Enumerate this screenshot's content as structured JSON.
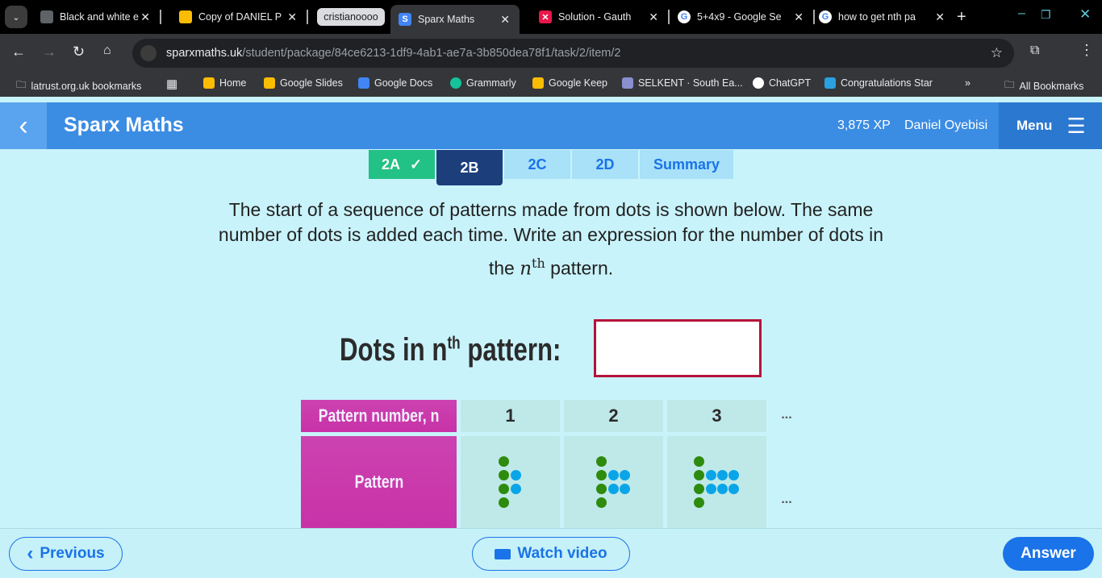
{
  "browser": {
    "tabs": [
      {
        "title": "Black and white e",
        "icon": "classroom-icon",
        "color": "#5f6368"
      },
      {
        "title": "Copy of DANIEL P",
        "icon": "slides-icon",
        "color": "#fbbc04"
      },
      {
        "title": "cristianoooo",
        "group": true
      },
      {
        "title": "Sparx Maths",
        "icon": "sparx-icon",
        "color": "#4285f4",
        "active": true
      },
      {
        "title": "Solution - Gauth",
        "icon": "gauth-icon",
        "color": "#e8174a"
      },
      {
        "title": "5+4x9 - Google Se",
        "icon": "google-icon",
        "color": "#ffffff"
      },
      {
        "title": "how to get nth pa",
        "icon": "google-icon",
        "color": "#ffffff"
      }
    ],
    "url_domain": "sparxmaths.uk",
    "url_path": "/student/package/84ce6213-1df9-4ab1-ae7a-3b850dea78f1/task/2/item/2",
    "bookmarks": [
      {
        "label": "latrust.org.uk bookmarks",
        "icon": "folder-icon"
      },
      {
        "label": "Home",
        "icon": "classroom-icon",
        "color": "#fbbc04"
      },
      {
        "label": "Google Slides",
        "icon": "slides-icon",
        "color": "#fbbc04"
      },
      {
        "label": "Google Docs",
        "icon": "docs-icon",
        "color": "#4285f4"
      },
      {
        "label": "Grammarly",
        "icon": "grammarly-icon",
        "color": "#15c39a"
      },
      {
        "label": "Google Keep",
        "icon": "keep-icon",
        "color": "#fbbc04"
      },
      {
        "label": "SELKENT · South Ea...",
        "icon": "selkent-icon",
        "color": "#8a8fd0"
      },
      {
        "label": "ChatGPT",
        "icon": "chatgpt-icon",
        "color": "#ffffff"
      },
      {
        "label": "Congratulations Star",
        "icon": "t-icon",
        "color": "#2aa1e0"
      }
    ],
    "all_bookmarks": "All Bookmarks"
  },
  "header": {
    "title": "Sparx Maths",
    "xp": "3,875 XP",
    "user": "Daniel Oyebisi",
    "menu": "Menu"
  },
  "task_tabs": [
    {
      "label": "2A",
      "state": "done"
    },
    {
      "label": "2B",
      "state": "active"
    },
    {
      "label": "2C",
      "state": "todo"
    },
    {
      "label": "2D",
      "state": "todo"
    },
    {
      "label": "Summary",
      "state": "todo"
    }
  ],
  "question": {
    "line1": "The start of a sequence of patterns made from dots is shown below. The same",
    "line2": "number of dots is added each time. Write an expression for the number of dots in",
    "line3_pre": "the ",
    "n": "n",
    "th": "th",
    "line3_post": " pattern."
  },
  "answer": {
    "label_pre": "Dots in n",
    "label_sup": "th",
    "label_post": " pattern:",
    "value": ""
  },
  "table": {
    "row1_header": "Pattern number, n",
    "row2_header": "Pattern",
    "columns": [
      "1",
      "2",
      "3"
    ],
    "ellipsis": "...",
    "patterns": [
      {
        "green": 4,
        "blue": 2
      },
      {
        "green": 4,
        "blue": 4
      },
      {
        "green": 4,
        "blue": 6
      }
    ],
    "colors": {
      "green": "#2e8b0e",
      "blue": "#0aa5e8",
      "header": "#c832a8",
      "cell": "#bfe9e8"
    }
  },
  "footer": {
    "previous": "Previous",
    "watch": "Watch video",
    "answer": "Answer"
  }
}
